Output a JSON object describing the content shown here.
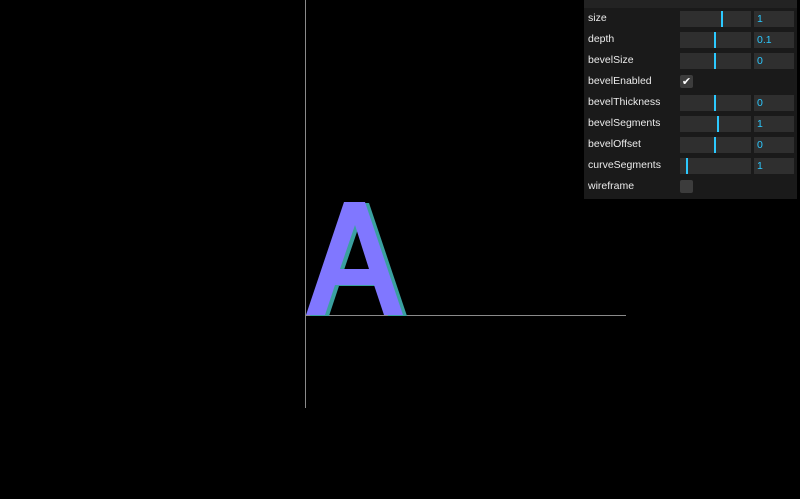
{
  "scene": {
    "glyph_text": "A",
    "glyph_color": "#8077ff",
    "glyph_edge_color": "#3aa0a0",
    "axis_color": "#8a8a8a"
  },
  "gui": {
    "accent_color": "#2cc9ff",
    "controls": [
      {
        "id": "size",
        "label": "size",
        "type": "slider",
        "value": "1",
        "fraction": 0.59
      },
      {
        "id": "depth",
        "label": "depth",
        "type": "slider",
        "value": "0.1",
        "fraction": 0.49
      },
      {
        "id": "bevelsize",
        "label": "bevelSize",
        "type": "slider",
        "value": "0",
        "fraction": 0.49
      },
      {
        "id": "bevelenabled",
        "label": "bevelEnabled",
        "type": "checkbox",
        "checked": true,
        "check_glyph": "✔"
      },
      {
        "id": "bevelthickness",
        "label": "bevelThickness",
        "type": "slider",
        "value": "0",
        "fraction": 0.49
      },
      {
        "id": "bevelsegments",
        "label": "bevelSegments",
        "type": "slider",
        "value": "1",
        "fraction": 0.54
      },
      {
        "id": "beveloffset",
        "label": "bevelOffset",
        "type": "slider",
        "value": "0",
        "fraction": 0.49
      },
      {
        "id": "curvesegments",
        "label": "curveSegments",
        "type": "slider",
        "value": "1",
        "fraction": 0.09
      },
      {
        "id": "wireframe",
        "label": "wireframe",
        "type": "checkbox",
        "checked": false,
        "check_glyph": ""
      }
    ]
  }
}
